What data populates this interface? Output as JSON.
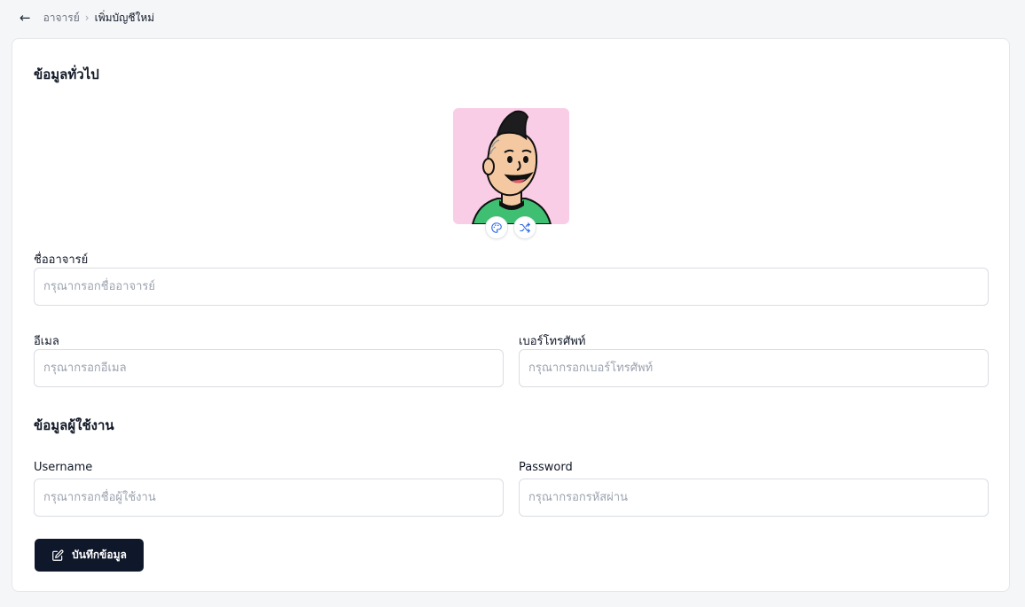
{
  "breadcrumb": {
    "back_icon": "arrow-left-icon",
    "parent": "อาจารย์",
    "separator": "›",
    "current": "เพิ่มบัญชีใหม่"
  },
  "general": {
    "title": "ข้อมูลทั่วไป",
    "avatar_background": "#f9cde6",
    "palette_icon": "palette-icon",
    "shuffle_icon": "shuffle-icon"
  },
  "fields": {
    "name": {
      "label": "ชื่ออาจารย์",
      "placeholder": "กรุณากรอกชื่ออาจารย์"
    },
    "email": {
      "label": "อีเมล",
      "placeholder": "กรุณากรอกอีเมล"
    },
    "phone": {
      "label": "เบอร์โทรศัพท์",
      "placeholder": "กรุณากรอกเบอร์โทรศัพท์"
    }
  },
  "account": {
    "title": "ข้อมูลผู้ใช้งาน",
    "username": {
      "label": "Username",
      "placeholder": "กรุณากรอกชื่อผู้ใช้งาน"
    },
    "password": {
      "label": "Password",
      "placeholder": "กรุณากรอกรหัสผ่าน"
    }
  },
  "save_button": {
    "label": "บันทึกข้อมูล",
    "icon": "edit-icon"
  },
  "colors": {
    "primary": "#0f172a",
    "border": "#d9dde3",
    "page_bg": "#f5f6f8"
  }
}
